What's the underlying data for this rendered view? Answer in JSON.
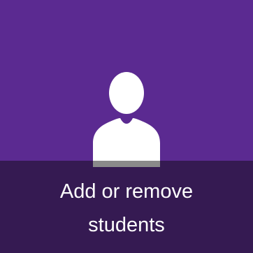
{
  "tile": {
    "label_line_1": "Add or remove",
    "label_line_2": "students",
    "icon": "person-icon",
    "colors": {
      "tile_background": "#5b2a91",
      "label_band": "#351a52",
      "icon_fill": "#ffffff",
      "icon_shadow": "#8a8a8a",
      "text": "#ffffff"
    }
  }
}
